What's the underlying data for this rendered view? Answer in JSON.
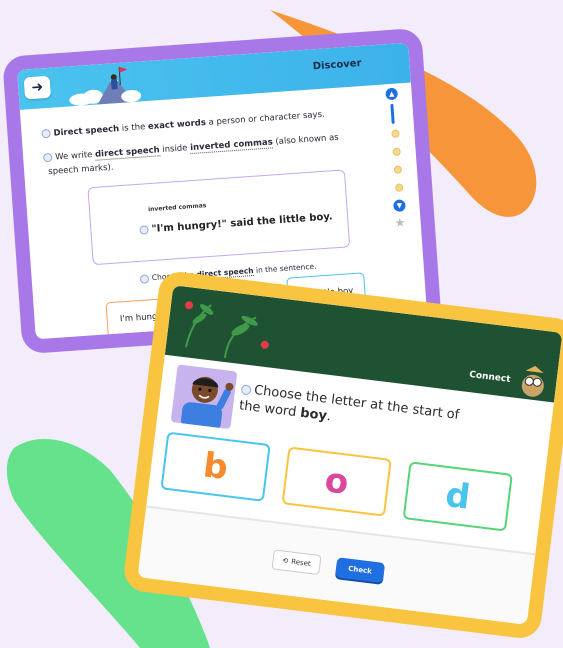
{
  "colors": {
    "background": "#f3ecfb",
    "orange_blob": "#f6953a",
    "green_blob": "#66e28c",
    "discover_frame": "#a877e8",
    "connect_frame": "#f9c440",
    "discover_header": "#4bc3ee",
    "connect_header": "#1f5233",
    "primary_button": "#1f6fe0"
  },
  "discover": {
    "header_label": "Discover",
    "back_icon": "arrow-right-icon",
    "line1": {
      "bold_a": "Direct speech",
      "mid": " is the ",
      "bold_b": "exact words",
      "end": " a person or character says."
    },
    "line2": {
      "start": "We write ",
      "term_a": "direct speech",
      "mid": " inside ",
      "term_b": "inverted commas",
      "end": " (also known as"
    },
    "line2b": "speech marks).",
    "example": {
      "label": "inverted commas",
      "sentence": "\"I'm hungry!\" said the little boy."
    },
    "instruction": {
      "start": "Choose the ",
      "term": "direct speech",
      "end": " in the sentence."
    },
    "choices": [
      "I'm hungry!",
      "the little boy"
    ]
  },
  "connect": {
    "header_label": "Connect",
    "question_start": "Choose the letter at the start of the word ",
    "question_word": "boy",
    "question_end": ".",
    "letters": [
      {
        "letter": "b",
        "color": "#f58a2e",
        "border": "#49c4ee"
      },
      {
        "letter": "o",
        "color": "#d9489b",
        "border": "#f9c440"
      },
      {
        "letter": "d",
        "color": "#49c4ee",
        "border": "#57d37a"
      }
    ],
    "reset_label": "Reset",
    "check_label": "Check"
  }
}
